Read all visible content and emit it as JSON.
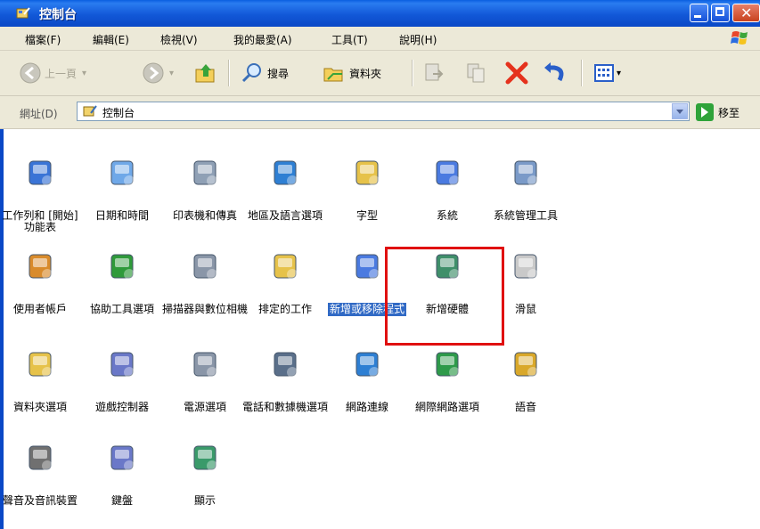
{
  "window": {
    "title": "控制台"
  },
  "menu": [
    "檔案(F)",
    "編輯(E)",
    "檢視(V)",
    "我的最愛(A)",
    "工具(T)",
    "說明(H)"
  ],
  "toolbar": {
    "back": "上一頁",
    "search": "搜尋",
    "folders": "資料夾"
  },
  "address": {
    "label": "網址(D)",
    "value": "控制台",
    "go": "移至"
  },
  "items": [
    {
      "label": "工作列和 [開始] 功能表",
      "icon": "taskbar-icon"
    },
    {
      "label": "日期和時間",
      "icon": "clock-icon"
    },
    {
      "label": "印表機和傳真",
      "icon": "printer-icon"
    },
    {
      "label": "地區及語言選項",
      "icon": "globe-icon"
    },
    {
      "label": "字型",
      "icon": "fonts-folder-icon"
    },
    {
      "label": "系統",
      "icon": "system-icon"
    },
    {
      "label": "系統管理工具",
      "icon": "admin-tools-icon"
    },
    {
      "label": "使用者帳戶",
      "icon": "users-icon"
    },
    {
      "label": "協助工具選項",
      "icon": "accessibility-icon"
    },
    {
      "label": "掃描器與數位相機",
      "icon": "scanner-icon"
    },
    {
      "label": "排定的工作",
      "icon": "scheduled-tasks-icon"
    },
    {
      "label": "新增或移除程式",
      "icon": "add-remove-icon"
    },
    {
      "label": "新增硬體",
      "icon": "hardware-icon"
    },
    {
      "label": "滑鼠",
      "icon": "mouse-icon"
    },
    {
      "label": "資料夾選項",
      "icon": "folder-options-icon"
    },
    {
      "label": "遊戲控制器",
      "icon": "gamepad-icon"
    },
    {
      "label": "電源選項",
      "icon": "power-icon"
    },
    {
      "label": "電話和數據機選項",
      "icon": "phone-icon"
    },
    {
      "label": "網路連線",
      "icon": "network-icon"
    },
    {
      "label": "網際網路選項",
      "icon": "internet-icon"
    },
    {
      "label": "語音",
      "icon": "speech-icon"
    },
    {
      "label": "聲音及音訊裝置",
      "icon": "speaker-icon"
    },
    {
      "label": "鍵盤",
      "icon": "keyboard-icon"
    },
    {
      "label": "顯示",
      "icon": "display-icon"
    }
  ],
  "colors": {
    "titlebar": "#0a5fe0",
    "selection": "#316ac5",
    "highlight": "#e01010"
  }
}
